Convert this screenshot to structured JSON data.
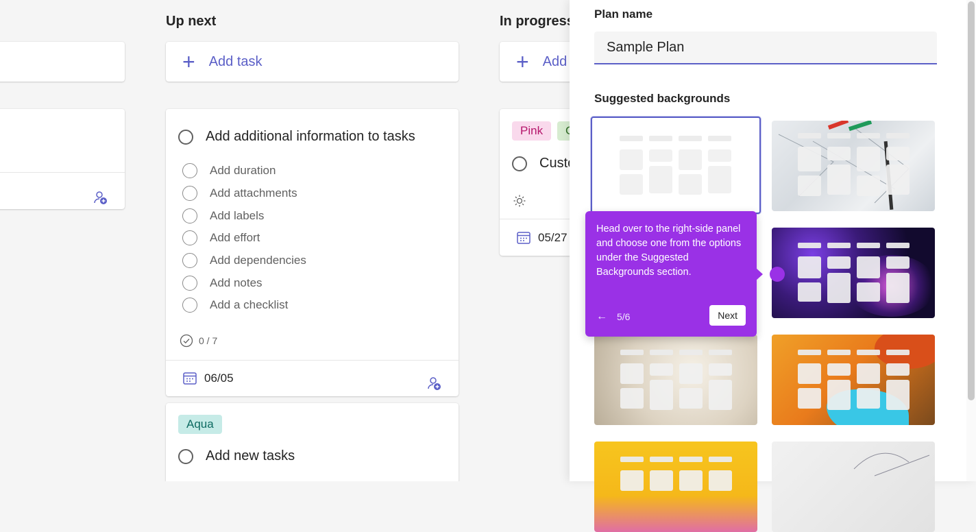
{
  "columns": {
    "up_next": {
      "title": "Up next",
      "add_task": "Add task",
      "card1": {
        "title": "Add additional information to tasks",
        "checklist": [
          "Add duration",
          "Add attachments",
          "Add labels",
          "Add effort",
          "Add dependencies",
          "Add notes",
          "Add a checklist"
        ],
        "progress": "0 / 7",
        "due_date": "06/05"
      },
      "card2": {
        "tag": "Aqua",
        "title": "Add new tasks"
      }
    },
    "in_progress": {
      "title": "In progress",
      "add_task": "Add",
      "card": {
        "tags": [
          "Pink",
          "G"
        ],
        "title": "Custo",
        "due_date": "05/27"
      }
    }
  },
  "panel": {
    "plan_name_label": "Plan name",
    "plan_name_value": "Sample Plan",
    "suggested_label": "Suggested backgrounds"
  },
  "tooltip": {
    "text": "Head over to the right-side panel and choose one from the options under the Suggested Backgrounds section.",
    "step": "5/6",
    "next_label": "Next"
  },
  "colors": {
    "accent": "#5b5fc7",
    "tooltip": "#9a31e6"
  }
}
